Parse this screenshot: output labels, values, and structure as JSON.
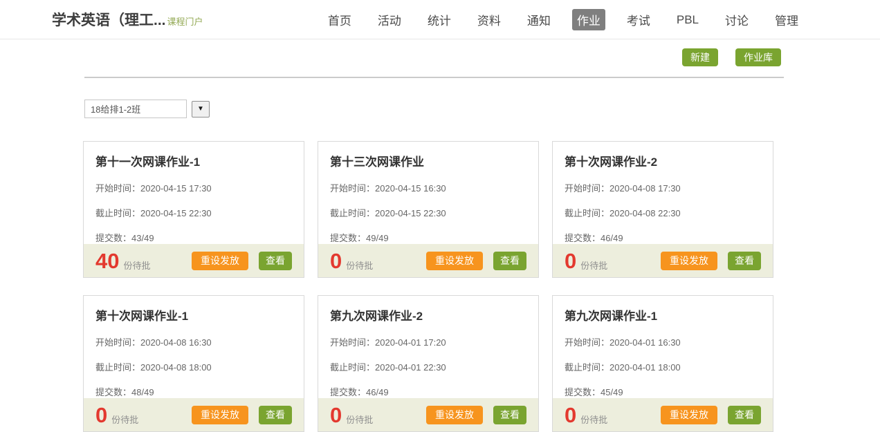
{
  "colors": {
    "accent_green": "#7aa430",
    "accent_orange": "#f7941e",
    "pending_red": "#e3392f",
    "footer_bg": "#edeedd",
    "nav_active_bg": "#7f7f7f",
    "portal_green": "#93a954"
  },
  "header": {
    "course_title": "学术英语（理工...",
    "portal_label": "课程门户",
    "nav": [
      {
        "label": "首页",
        "active": false
      },
      {
        "label": "活动",
        "active": false
      },
      {
        "label": "统计",
        "active": false
      },
      {
        "label": "资料",
        "active": false
      },
      {
        "label": "通知",
        "active": false
      },
      {
        "label": "作业",
        "active": true
      },
      {
        "label": "考试",
        "active": false
      },
      {
        "label": "PBL",
        "active": false
      },
      {
        "label": "讨论",
        "active": false
      },
      {
        "label": "管理",
        "active": false
      }
    ]
  },
  "toolbar": {
    "new_label": "新建",
    "library_label": "作业库"
  },
  "filter": {
    "selected_class": "18给排1-2班"
  },
  "icons": {
    "dropdown_arrow": "▼"
  },
  "labels": {
    "start_time": "开始时间：",
    "end_time": "截止时间：",
    "submissions": "提交数：",
    "pending_suffix": "份待批",
    "reset_button": "重设发放",
    "view_button": "查看"
  },
  "assignments": [
    {
      "title": "第十一次网课作业-1",
      "start": "2020-04-15 17:30",
      "end": "2020-04-15 22:30",
      "submitted": "43/49",
      "pending": "40"
    },
    {
      "title": "第十三次网课作业",
      "start": "2020-04-15 16:30",
      "end": "2020-04-15 22:30",
      "submitted": "49/49",
      "pending": "0"
    },
    {
      "title": "第十次网课作业-2",
      "start": "2020-04-08 17:30",
      "end": "2020-04-08 22:30",
      "submitted": "46/49",
      "pending": "0"
    },
    {
      "title": "第十次网课作业-1",
      "start": "2020-04-08 16:30",
      "end": "2020-04-08 18:00",
      "submitted": "48/49",
      "pending": "0"
    },
    {
      "title": "第九次网课作业-2",
      "start": "2020-04-01 17:20",
      "end": "2020-04-01 22:30",
      "submitted": "46/49",
      "pending": "0"
    },
    {
      "title": "第九次网课作业-1",
      "start": "2020-04-01 16:30",
      "end": "2020-04-01 18:00",
      "submitted": "45/49",
      "pending": "0"
    }
  ]
}
